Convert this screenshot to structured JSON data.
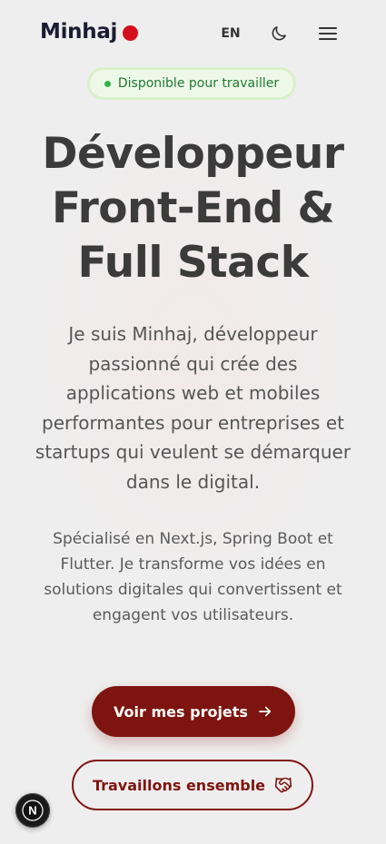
{
  "header": {
    "logo_text": "Minhaj",
    "language_label": "EN"
  },
  "icons": {
    "theme": "moon-icon",
    "menu": "hamburger-menu-icon",
    "primary_cta": "arrow-right-icon",
    "secondary_cta": "handshake-icon",
    "dev_badge": "nextjs-icon"
  },
  "status_badge": {
    "text": "Disponible pour travailler"
  },
  "hero": {
    "title_lines": [
      "Développeur",
      "Front-End &",
      "Full Stack"
    ],
    "intro_lines": [
      "Je suis Minhaj, développeur",
      "passionné qui crée des",
      "applications web et mobiles",
      "performantes pour entreprises et",
      "startups qui veulent se démarquer",
      "dans le digital."
    ],
    "specialty_lines": [
      "Spécialisé en Next.js, Spring Boot et",
      "Flutter. Je transforme vos idées en",
      "solutions digitales qui convertissent et",
      "engagent vos utilisateurs."
    ]
  },
  "actions": {
    "primary_label": "Voir mes projets",
    "secondary_label": "Travaillons ensemble"
  },
  "dev_badge": {
    "letter": "N"
  },
  "colors": {
    "brand_dot": "#d4101e",
    "accent": "#7e140f",
    "status_green": "#2fb24a",
    "background": "#efeeee"
  }
}
